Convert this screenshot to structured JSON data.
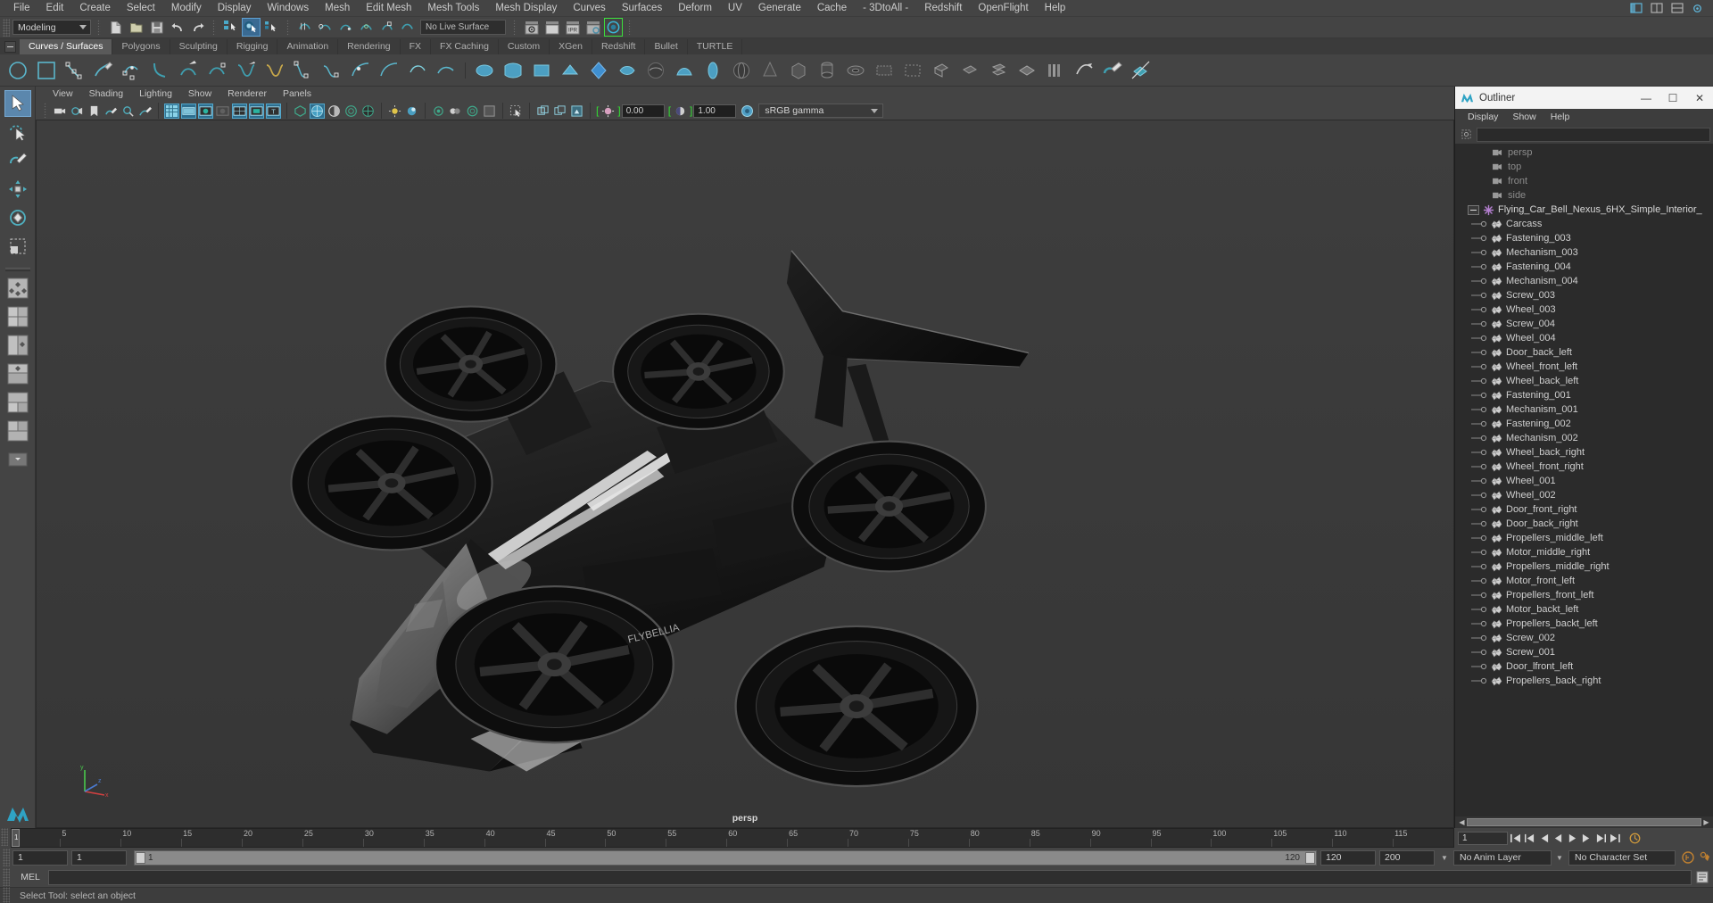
{
  "menubar": {
    "items": [
      "File",
      "Edit",
      "Create",
      "Select",
      "Modify",
      "Display",
      "Windows",
      "Mesh",
      "Edit Mesh",
      "Mesh Tools",
      "Mesh Display",
      "Curves",
      "Surfaces",
      "Deform",
      "UV",
      "Generate",
      "Cache",
      "- 3DtoAll -",
      "Redshift",
      "OpenFlight",
      "Help"
    ]
  },
  "statusbar": {
    "menuset": "Modeling",
    "live_surface": "No Live Surface",
    "icons": [
      "new-scene-icon",
      "open-scene-icon",
      "save-scene-icon",
      "undo-icon",
      "redo-icon",
      "select-by-hierarchy-icon",
      "select-by-object-icon",
      "select-by-component-icon",
      "snap-to-grid-icon",
      "snap-to-curve-icon",
      "snap-to-point-icon",
      "snap-to-projected-center-icon",
      "snap-to-view-plane-icon",
      "make-live-icon",
      "render-current-frame-icon",
      "render-sequence-icon",
      "ipr-render-icon",
      "render-settings-icon",
      "hypershade-icon"
    ]
  },
  "shelf": {
    "tabs": [
      "Curves / Surfaces",
      "Polygons",
      "Sculpting",
      "Rigging",
      "Animation",
      "Rendering",
      "FX",
      "FX Caching",
      "Custom",
      "XGen",
      "Redshift",
      "Bullet",
      "TURTLE"
    ],
    "active_tab": "Curves / Surfaces",
    "icon_names": [
      "circle-curve-icon",
      "square-curve-icon",
      "cv-curve-icon",
      "pencil-curve-icon",
      "ep-curve-icon",
      "bezier-curve-icon",
      "arc-three-point-icon",
      "attach-curves-icon",
      "detach-curves-icon",
      "offset-curve-icon",
      "curve-fillet-icon",
      "cut-curve-icon",
      "insert-knot-icon",
      "extend-curve-icon",
      "rebuild-curve-icon",
      "smooth-curve-icon",
      "revolve-icon",
      "loft-icon",
      "planar-icon",
      "extrude-icon",
      "birail-icon",
      "boundary-icon",
      "square-surface-icon",
      "bevel-icon",
      "bevel-plus-icon",
      "sphere-nurbs-icon",
      "cube-nurbs-icon",
      "cylinder-nurbs-icon",
      "cone-nurbs-icon",
      "plane-nurbs-icon",
      "torus-nurbs-icon",
      "intersect-surfaces-icon",
      "project-curve-icon",
      "trim-tool-icon",
      "untrim-icon",
      "attach-surfaces-icon",
      "detach-surfaces-icon",
      "align-surfaces-icon",
      "surface-fillet-icon",
      "stitch-icon",
      "sculpt-geometry-icon",
      "surface-editing-icon"
    ]
  },
  "toolbox": {
    "tools": [
      "select-tool",
      "lasso-select-tool",
      "paint-select-tool",
      "move-tool",
      "rotate-tool",
      "scale-tool",
      "last-tool-used",
      "four-view-layout",
      "persp-outliner-layout",
      "persp-graph-layout",
      "hypershade-persp-layout",
      "persp-uv-layout",
      "two-pane-layout",
      "single-perspective-layout"
    ],
    "active_tool": "select-tool"
  },
  "viewport": {
    "panel_menu": [
      "View",
      "Shading",
      "Lighting",
      "Show",
      "Renderer",
      "Panels"
    ],
    "camera_label": "persp",
    "exposure": "0.00",
    "gamma": "1.00",
    "color_management": "sRGB gamma",
    "axis_labels": {
      "x": "x",
      "y": "y",
      "z": "z"
    },
    "toolbar_icons": [
      "camera-select-icon",
      "camera-attributes-icon",
      "bookmark-icon",
      "image-plane-icon",
      "two-d-pan-zoom-icon",
      "grease-pencil-icon",
      "grid-toggle-icon",
      "film-gate-icon",
      "resolution-gate-icon",
      "gate-mask-icon",
      "film-origin-icon",
      "field-chart-icon",
      "safe-action-icon",
      "safe-title-icon",
      "wireframe-icon",
      "smooth-shade-all-icon",
      "shaded-wireframe-icon",
      "textured-icon",
      "use-all-lights-icon",
      "shadows-icon",
      "screen-space-ao-icon",
      "motion-blur-icon",
      "multisample-icon",
      "depth-of-field-icon",
      "isolate-select-icon",
      "xray-icon",
      "xray-joints-icon",
      "xray-active-components-icon",
      "exposure-icon",
      "gamma-icon",
      "color-management-icon"
    ]
  },
  "outliner": {
    "title": "Outliner",
    "window_buttons": {
      "minimize": "—",
      "maximize": "☐",
      "close": "✕"
    },
    "menus": [
      "Display",
      "Show",
      "Help"
    ],
    "search_value": "",
    "items": [
      {
        "name": "persp",
        "type": "camera",
        "depth": 1
      },
      {
        "name": "top",
        "type": "camera",
        "depth": 1
      },
      {
        "name": "front",
        "type": "camera",
        "depth": 1
      },
      {
        "name": "side",
        "type": "camera",
        "depth": 1
      },
      {
        "name": "Flying_Car_Bell_Nexus_6HX_Simple_Interior_",
        "type": "group",
        "depth": 0
      },
      {
        "name": "Carcass",
        "type": "mesh",
        "depth": 1
      },
      {
        "name": "Fastening_003",
        "type": "mesh",
        "depth": 1
      },
      {
        "name": "Mechanism_003",
        "type": "mesh",
        "depth": 1
      },
      {
        "name": "Fastening_004",
        "type": "mesh",
        "depth": 1
      },
      {
        "name": "Mechanism_004",
        "type": "mesh",
        "depth": 1
      },
      {
        "name": "Screw_003",
        "type": "mesh",
        "depth": 1
      },
      {
        "name": "Wheel_003",
        "type": "mesh",
        "depth": 1
      },
      {
        "name": "Screw_004",
        "type": "mesh",
        "depth": 1
      },
      {
        "name": "Wheel_004",
        "type": "mesh",
        "depth": 1
      },
      {
        "name": "Door_back_left",
        "type": "mesh",
        "depth": 1
      },
      {
        "name": "Wheel_front_left",
        "type": "mesh",
        "depth": 1
      },
      {
        "name": "Wheel_back_left",
        "type": "mesh",
        "depth": 1
      },
      {
        "name": "Fastening_001",
        "type": "mesh",
        "depth": 1
      },
      {
        "name": "Mechanism_001",
        "type": "mesh",
        "depth": 1
      },
      {
        "name": "Fastening_002",
        "type": "mesh",
        "depth": 1
      },
      {
        "name": "Mechanism_002",
        "type": "mesh",
        "depth": 1
      },
      {
        "name": "Wheel_back_right",
        "type": "mesh",
        "depth": 1
      },
      {
        "name": "Wheel_front_right",
        "type": "mesh",
        "depth": 1
      },
      {
        "name": "Wheel_001",
        "type": "mesh",
        "depth": 1
      },
      {
        "name": "Wheel_002",
        "type": "mesh",
        "depth": 1
      },
      {
        "name": "Door_front_right",
        "type": "mesh",
        "depth": 1
      },
      {
        "name": "Door_back_right",
        "type": "mesh",
        "depth": 1
      },
      {
        "name": "Propellers_middle_left",
        "type": "mesh",
        "depth": 1
      },
      {
        "name": "Motor_middle_right",
        "type": "mesh",
        "depth": 1
      },
      {
        "name": "Propellers_middle_right",
        "type": "mesh",
        "depth": 1
      },
      {
        "name": "Motor_front_left",
        "type": "mesh",
        "depth": 1
      },
      {
        "name": "Propellers_front_left",
        "type": "mesh",
        "depth": 1
      },
      {
        "name": "Motor_backt_left",
        "type": "mesh",
        "depth": 1
      },
      {
        "name": "Propellers_backt_left",
        "type": "mesh",
        "depth": 1
      },
      {
        "name": "Screw_002",
        "type": "mesh",
        "depth": 1
      },
      {
        "name": "Screw_001",
        "type": "mesh",
        "depth": 1
      },
      {
        "name": "Door_lfront_left",
        "type": "mesh",
        "depth": 1
      },
      {
        "name": "Propellers_back_right",
        "type": "mesh",
        "depth": 1
      }
    ]
  },
  "timeline": {
    "current_frame": "1",
    "tick_labels": [
      "5",
      "10",
      "15",
      "20",
      "25",
      "30",
      "35",
      "40",
      "45",
      "50",
      "55",
      "60",
      "65",
      "70",
      "75",
      "80",
      "85",
      "90",
      "95",
      "100",
      "105",
      "110",
      "115"
    ],
    "tick_start": 5,
    "tick_step": 5,
    "range_start": 1,
    "range_end": 120,
    "playback_field": "1"
  },
  "rangebar": {
    "anim_start": "1",
    "range_start": "1",
    "slider_min_label": "1",
    "slider_max_label": "120",
    "range_end": "120",
    "anim_end": "200",
    "anim_layer": "No Anim Layer",
    "character_set": "No Character Set"
  },
  "playback": {
    "field": "1",
    "buttons": [
      "go-to-start",
      "step-back-frame",
      "step-back-key",
      "play-backwards",
      "play-forwards",
      "step-forward-key",
      "step-forward-frame",
      "go-to-end"
    ]
  },
  "commandline": {
    "label": "MEL",
    "value": "",
    "placeholder": ""
  },
  "helpline": {
    "text": "Select Tool: select an object"
  },
  "colors": {
    "bg": "#444444",
    "panel_dark": "#2b2b2b",
    "accent_blue": "#5b87ad",
    "highlight_green": "#33dd33",
    "title_light": "#f3f3f3",
    "viewport_bg": "#3a3a3a",
    "nurbs_cyan": "#3f9fb0"
  }
}
